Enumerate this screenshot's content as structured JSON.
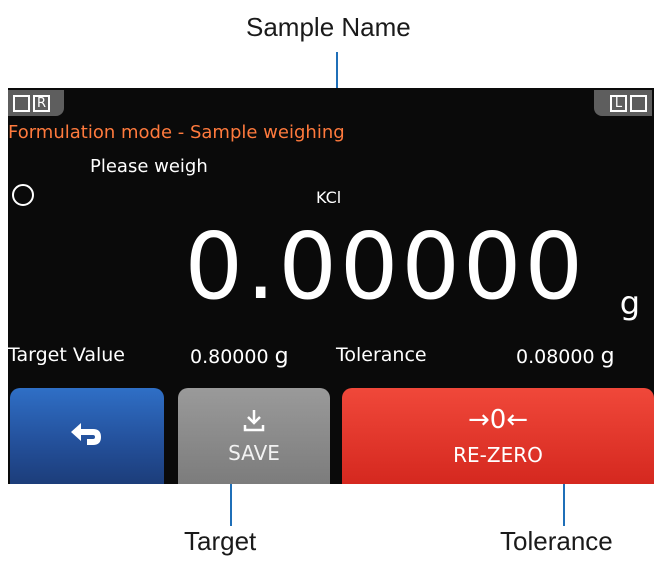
{
  "annotations": {
    "sample_name_label": "Sample Name",
    "target_label": "Target",
    "tolerance_label": "Tolerance"
  },
  "screen": {
    "left_tab": {
      "box": "",
      "letter": "R"
    },
    "right_tab": {
      "letter": "L",
      "box": ""
    },
    "mode_title": "Formulation mode - Sample weighing",
    "instruction": "Please weigh",
    "status_icon": "circle-outline-icon",
    "sample_name": "KCl",
    "weight": {
      "value": "0.00000",
      "unit": "g"
    },
    "target": {
      "label": "Target Value",
      "value": "0.80000",
      "unit": "g"
    },
    "tolerance": {
      "label": "Tolerance",
      "value": "0.08000",
      "unit": "g"
    },
    "buttons": {
      "return": {
        "icon": "return-arrow-icon"
      },
      "save": {
        "icon": "download-icon",
        "label": "SAVE"
      },
      "rezero": {
        "icon": "rezero-icon",
        "icon_text": "→0←",
        "label": "RE-ZERO"
      }
    }
  },
  "colors": {
    "mode_title": "#ff7a3d",
    "return_button": "#24519c",
    "save_button": "#8a8a8a",
    "rezero_button": "#e03a2d",
    "callout_line": "#1f6fb8"
  }
}
